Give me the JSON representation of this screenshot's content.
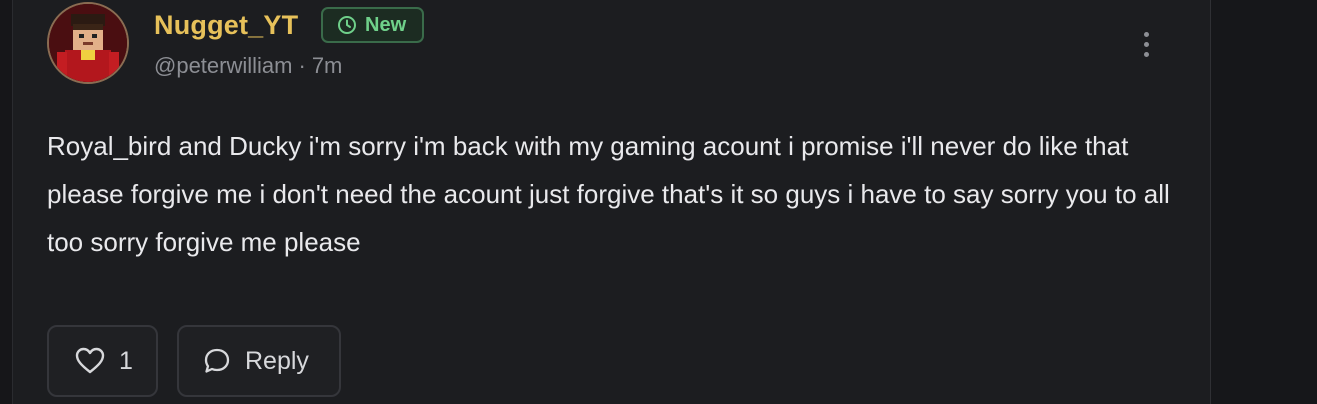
{
  "post": {
    "author": {
      "display_name": "Nugget_YT",
      "handle": "@peterwilliam",
      "separator": "·",
      "time_ago": "7m",
      "badge": {
        "label": "New",
        "icon": "clock-icon",
        "color": "#6fd08a"
      },
      "name_color": "#e7c15a"
    },
    "body": "Royal_bird and Ducky i'm sorry i'm back with my gaming acount i promise i'll never do like that please forgive me i don't need the acount just forgive that's it so guys i have to say sorry you to all too sorry forgive me please",
    "actions": {
      "like": {
        "icon": "heart-icon",
        "count": "1"
      },
      "reply": {
        "icon": "speech-bubble-icon",
        "label": "Reply"
      },
      "more": {
        "icon": "kebab-menu-icon"
      }
    }
  }
}
